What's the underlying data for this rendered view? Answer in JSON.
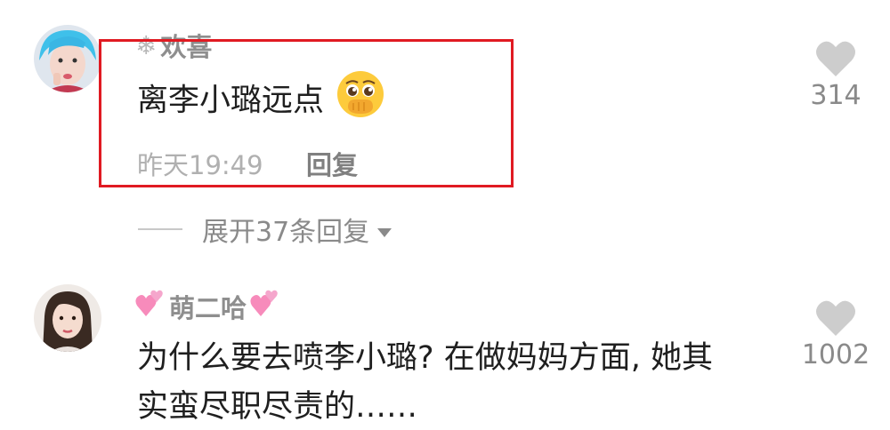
{
  "comments": [
    {
      "username": "欢喜",
      "text": "离李小璐远点",
      "time": "昨天19:49",
      "reply_label": "回复",
      "likes": "314"
    },
    {
      "username": "萌二哈",
      "text_line1": "为什么要去喷李小璐? 在做妈妈方面, 她其",
      "text_line2": "实蛮尽职尽责的……",
      "likes": "1002"
    }
  ],
  "expand_replies": "展开37条回复",
  "colors": {
    "highlight": "#e01a22",
    "heart": "#cdcdcd",
    "username": "#8e8e8e",
    "text": "#1f1f1f"
  }
}
